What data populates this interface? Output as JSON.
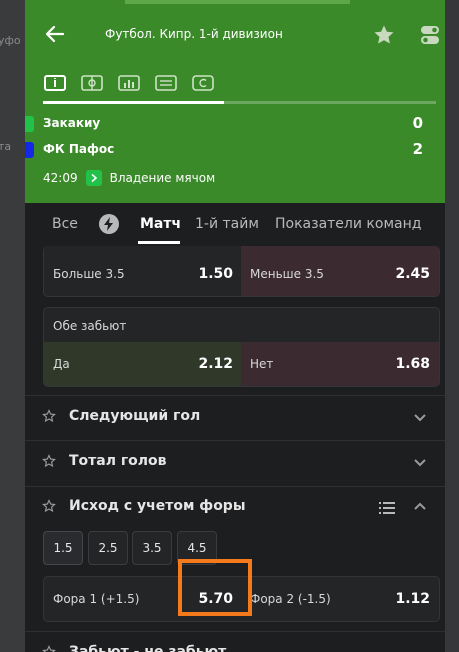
{
  "left_strip": {
    "text1": "уфо",
    "text2": "та"
  },
  "header": {
    "title": "Футбол. Кипр. 1-й дивизион"
  },
  "icon_tabs": [
    "scoreboard-icon",
    "field-icon",
    "stats-icon",
    "lineup-icon",
    "events-icon"
  ],
  "progress": {
    "value": 0.46
  },
  "match": {
    "teams": [
      {
        "name": "Закакиу",
        "score": "0",
        "color": "#22c24a"
      },
      {
        "name": "ФК Пафос",
        "score": "2",
        "color": "#1428e6"
      }
    ],
    "time": "42:09",
    "status": "Владение мячом"
  },
  "category_tabs": {
    "all": "Все",
    "match": "Матч",
    "first_half": "1-й тайм",
    "team_stats": "Показатели команд"
  },
  "totals": {
    "over_label": "Больше 3.5",
    "over_odds": "1.50",
    "under_label": "Меньше 3.5",
    "under_odds": "2.45"
  },
  "both_score": {
    "title": "Обе забьют",
    "yes_label": "Да",
    "yes_odds": "2.12",
    "no_label": "Нет",
    "no_odds": "1.68"
  },
  "sections": {
    "next_goal": "Следующий гол",
    "total_goals": "Тотал голов",
    "handicap": "Исход с учетом форы",
    "next": "Забьют - не забьют"
  },
  "handicap": {
    "options": [
      "1.5",
      "2.5",
      "3.5",
      "4.5"
    ],
    "h1_label": "Фора 1 (+1.5)",
    "h1_odds": "5.70",
    "h2_label": "Фора 2  (-1.5)",
    "h2_odds": "1.12"
  },
  "colors": {
    "header_green": "#3b8a2a",
    "highlight": "#f57a1c"
  }
}
